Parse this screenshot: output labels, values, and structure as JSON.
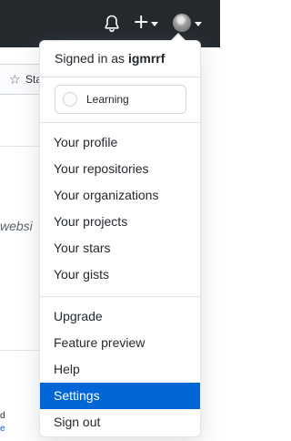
{
  "header": {
    "notifications_icon": "bell-icon",
    "create_icon": "plus-icon",
    "create_glyph": "+",
    "avatar_icon": "avatar"
  },
  "background": {
    "star_glyph": "☆",
    "star_label": "Sta",
    "website_text": "websi",
    "line_d": "d",
    "line_e": "e"
  },
  "menu": {
    "signed_in_prefix": "Signed in as",
    "username": "igmrrf",
    "status_label": "Learning",
    "group1": [
      "Your profile",
      "Your repositories",
      "Your organizations",
      "Your projects",
      "Your stars",
      "Your gists"
    ],
    "group2": [
      "Upgrade",
      "Feature preview",
      "Help",
      "Settings",
      "Sign out"
    ],
    "active_item": "Settings"
  },
  "colors": {
    "header_bg": "#24292e",
    "active_bg": "#0366d6",
    "border": "#e1e4e8"
  }
}
